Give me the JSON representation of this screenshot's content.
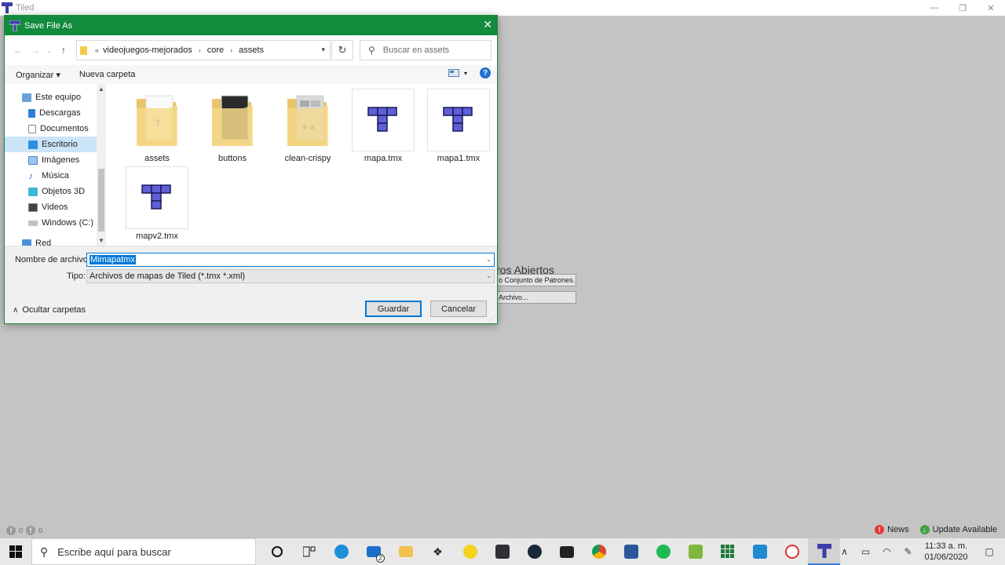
{
  "tiled": {
    "title": "Tiled",
    "recent_title": "ros Abiertos",
    "btn_tileset": "o Conjunto de Patrones...",
    "btn_file": "Archivo...",
    "status_counts": [
      "0",
      "0"
    ],
    "news_label": "News",
    "update_label": "Update Available"
  },
  "dialog": {
    "title": "Save File As",
    "breadcrumb": [
      "videojuegos-mejorados",
      "core",
      "assets"
    ],
    "search_placeholder": "Buscar en assets",
    "organize_label": "Organizar",
    "new_folder_label": "Nueva carpeta",
    "nav_items": [
      {
        "label": "Este equipo",
        "icon": "computer-icon"
      },
      {
        "label": "Descargas",
        "icon": "download-icon"
      },
      {
        "label": "Documentos",
        "icon": "documents-icon"
      },
      {
        "label": "Escritorio",
        "icon": "desktop-icon",
        "selected": true
      },
      {
        "label": "Imágenes",
        "icon": "pictures-icon"
      },
      {
        "label": "Música",
        "icon": "music-icon"
      },
      {
        "label": "Objetos 3D",
        "icon": "objects3d-icon"
      },
      {
        "label": "Videos",
        "icon": "videos-icon"
      },
      {
        "label": "Windows (C:)",
        "icon": "drive-icon"
      },
      {
        "label": "Red",
        "icon": "network-icon"
      }
    ],
    "files": [
      {
        "name": "assets",
        "kind": "folder"
      },
      {
        "name": "buttons",
        "kind": "folder"
      },
      {
        "name": "clean-crispy",
        "kind": "folder"
      },
      {
        "name": "mapa.tmx",
        "kind": "tmx"
      },
      {
        "name": "mapa1.tmx",
        "kind": "tmx"
      },
      {
        "name": "mapv2.tmx",
        "kind": "tmx"
      }
    ],
    "filename_label": "Nombre de archivo:",
    "filename_value": "Mimapatmx",
    "type_label": "Tipo:",
    "type_value": "Archivos de mapas de Tiled (*.tmx *.xml)",
    "hide_folders_label": "Ocultar carpetas",
    "save_label": "Guardar",
    "cancel_label": "Cancelar"
  },
  "taskbar": {
    "search_placeholder": "Escribe aquí para buscar",
    "mail_badge": "2",
    "time": "11:33 a. m.",
    "date": "01/06/2020"
  },
  "colors": {
    "dialog_title": "#128b3c",
    "accent": "#0078d7",
    "tiled_logo": "#3d3da8"
  }
}
